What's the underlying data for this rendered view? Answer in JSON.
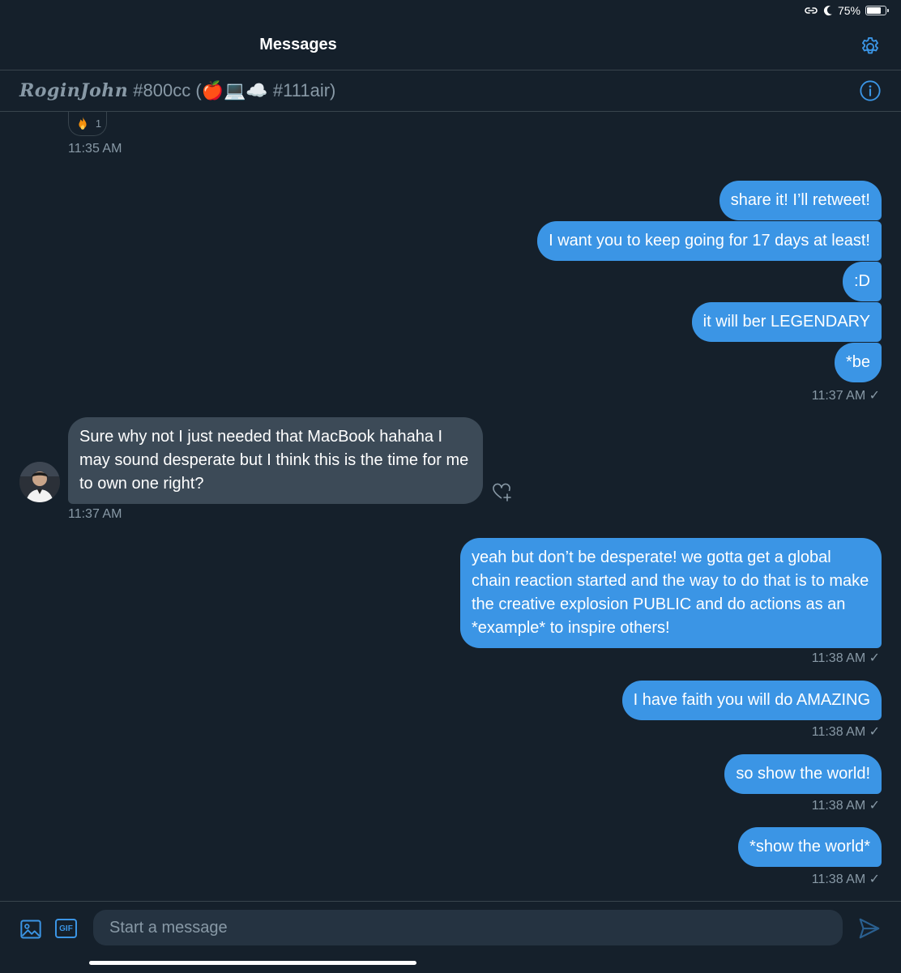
{
  "status_bar": {
    "battery_text": "75%",
    "battery_level": 0.75,
    "icons": [
      "link-icon",
      "moon-icon",
      "battery-icon"
    ]
  },
  "header": {
    "title": "Messages",
    "settings_icon": "gear-icon"
  },
  "conversation": {
    "name": "RoginJohn",
    "handle_suffix": "#800cc (🍎💻☁️ #111air)",
    "info_icon": "info-icon"
  },
  "reaction": {
    "emoji": "🔥",
    "count": "1"
  },
  "messages": [
    {
      "time": "11:35 AM"
    },
    {
      "text": "share it! I’ll retweet!"
    },
    {
      "text": "I want you to keep going for 17 days at least!"
    },
    {
      "text": ":D"
    },
    {
      "text": "it will ber LEGENDARY"
    },
    {
      "text": "*be",
      "time": "11:37 AM ✓"
    },
    {
      "text": "Sure why not I just needed that MacBook hahaha I may sound desperate but I think this is the time for me to own one right?",
      "time": "11:37 AM"
    },
    {
      "text": "yeah but don’t be desperate! we gotta get a global chain reaction started and the way to do that is to make the creative explosion PUBLIC and do actions as an *example* to inspire others!",
      "time": "11:38 AM ✓"
    },
    {
      "text": "I have faith you will do AMAZING",
      "time": "11:38 AM ✓"
    },
    {
      "text": "so show the world!",
      "time": "11:38 AM ✓"
    },
    {
      "text": "*show the world*",
      "time": "11:38 AM ✓"
    }
  ],
  "composer": {
    "placeholder": "Start a message",
    "gif_label": "GIF",
    "media_icon": "image-icon",
    "send_icon": "send-icon"
  },
  "colors": {
    "background": "#15202b",
    "accent": "#3b95e5",
    "incoming_bubble": "#3c4a57",
    "muted_text": "#8899a6",
    "divider": "#38444d"
  }
}
